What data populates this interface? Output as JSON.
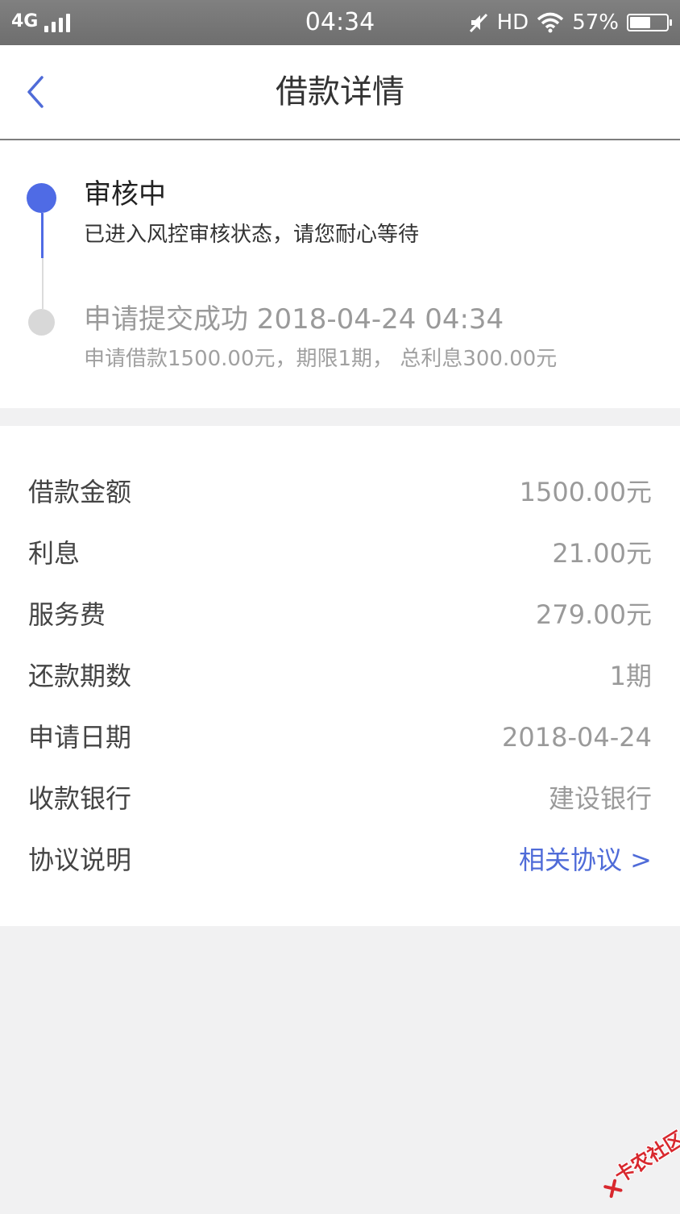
{
  "status_bar": {
    "network": "4G",
    "time": "04:34",
    "hd": "HD",
    "battery_percent": "57%",
    "battery_level": 0.57,
    "icons": [
      "signal-icon",
      "mute-icon",
      "wifi-icon",
      "battery-icon"
    ]
  },
  "nav": {
    "title": "借款详情",
    "back_icon": "chevron-left-icon"
  },
  "timeline": {
    "steps": [
      {
        "title": "审核中",
        "description": "已进入风控审核状态，请您耐心等待",
        "active": true
      },
      {
        "title": "申请提交成功 2018-04-24 04:34",
        "description": "申请借款1500.00元，期限1期， 总利息300.00元",
        "active": false
      }
    ]
  },
  "details": [
    {
      "label": "借款金额",
      "value": "1500.00元"
    },
    {
      "label": "利息",
      "value": "21.00元"
    },
    {
      "label": "服务费",
      "value": "279.00元"
    },
    {
      "label": "还款期数",
      "value": "1期"
    },
    {
      "label": "申请日期",
      "value": "2018-04-24"
    },
    {
      "label": "收款银行",
      "value": "建设银行"
    },
    {
      "label": "协议说明",
      "value": "相关协议 >"
    }
  ],
  "watermark": {
    "text": "卡农社区"
  },
  "colors": {
    "accent": "#4f6be5",
    "link": "#4f6bd8",
    "inactive": "#d8d8d8",
    "background": "#f1f1f2",
    "watermark": "#d8282e"
  }
}
